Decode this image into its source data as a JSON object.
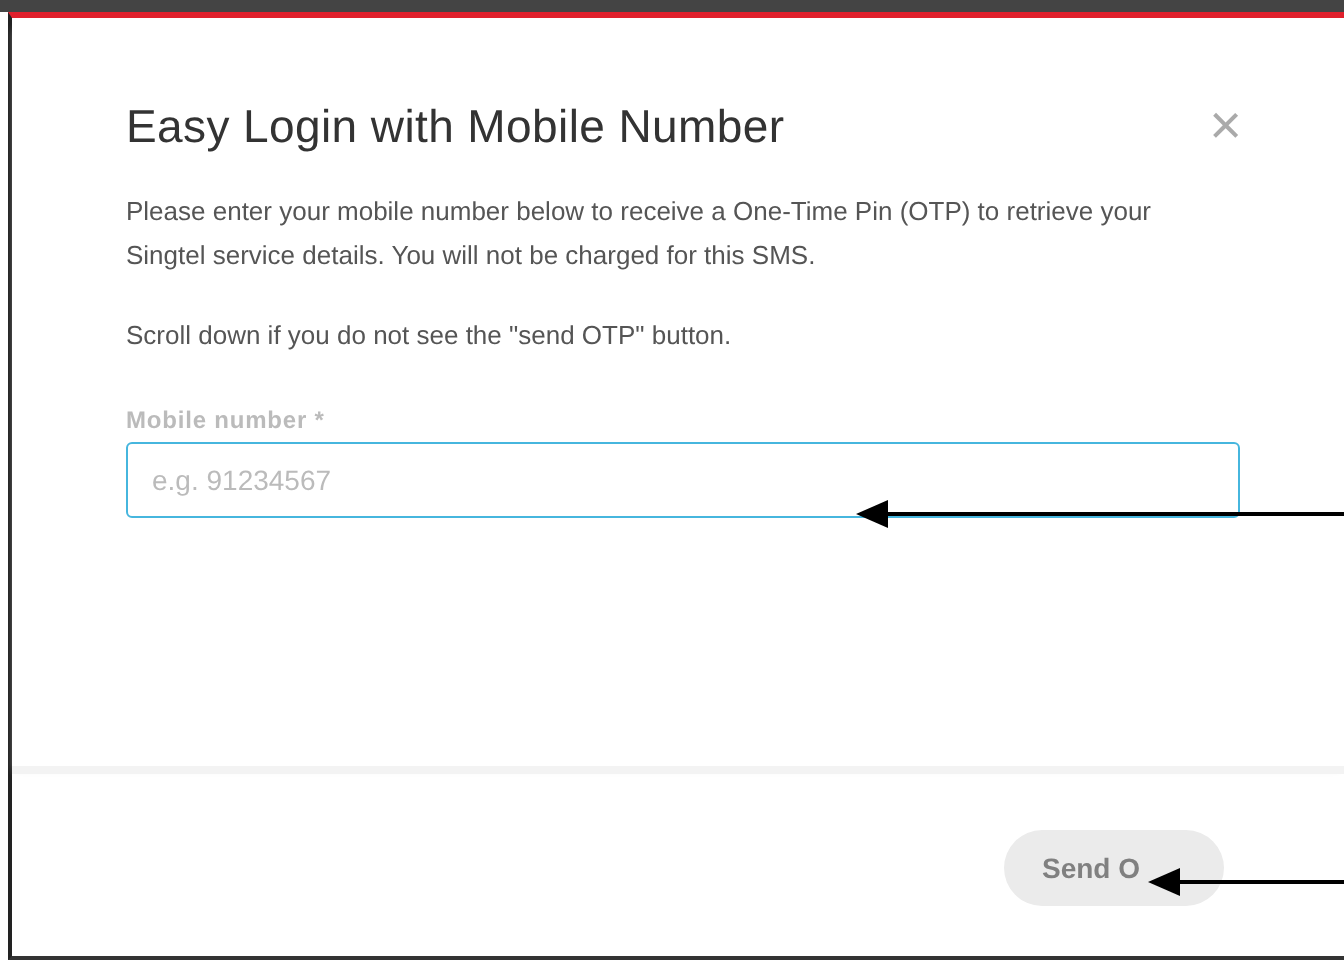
{
  "dialog": {
    "title": "Easy Login with Mobile Number",
    "close": "×",
    "paragraphs": [
      "Please enter your mobile number below to receive a One-Time Pin (OTP) to retrieve your Singtel service details. You will not be charged for this SMS.",
      "Scroll down if you do not see the \"send OTP\" button."
    ],
    "field": {
      "label": "Mobile number *",
      "placeholder": "e.g. 91234567"
    },
    "button": {
      "label": "Send O",
      "disabled": true
    }
  }
}
